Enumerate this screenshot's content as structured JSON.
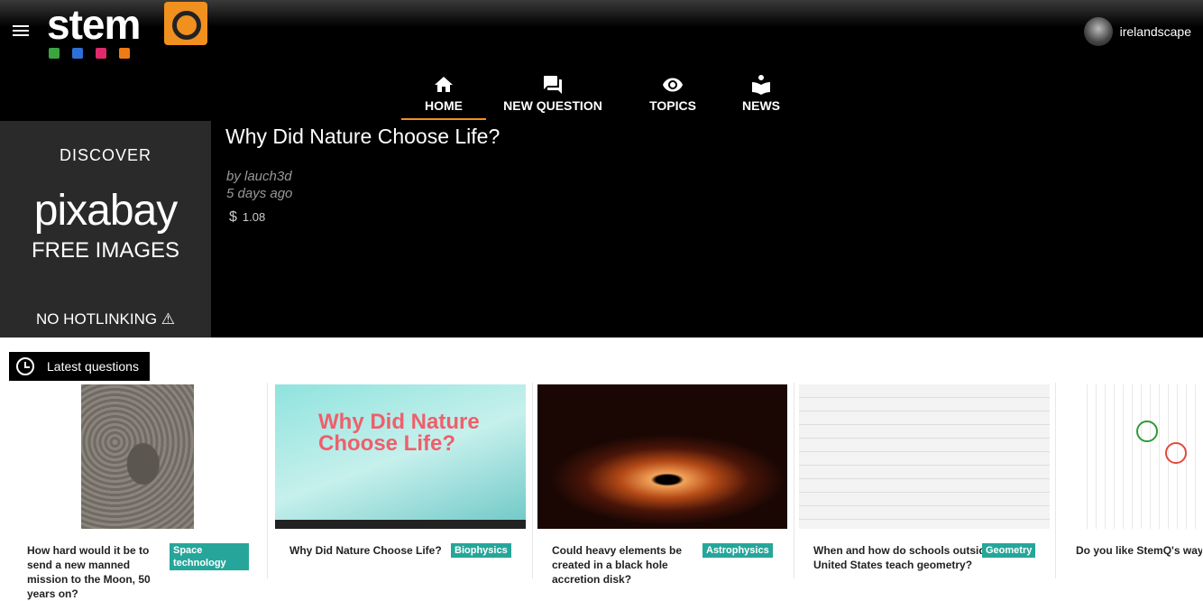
{
  "header": {
    "logo_text": "stem",
    "user": {
      "name": "irelandscape"
    }
  },
  "nav": [
    {
      "label": "HOME",
      "icon": "home-icon",
      "active": true
    },
    {
      "label": "NEW QUESTION",
      "icon": "forum-icon",
      "active": false
    },
    {
      "label": "TOPICS",
      "icon": "eye-icon",
      "active": false
    },
    {
      "label": "NEWS",
      "icon": "book-reader-icon",
      "active": false
    }
  ],
  "ad": {
    "line1": "DISCOVER",
    "line2": "pixabay",
    "line3": "FREE IMAGES",
    "line4": "NO HOTLINKING ⚠"
  },
  "featured": {
    "title": "Why Did Nature Choose Life?",
    "author": "by lauch3d",
    "time": "5 days ago",
    "currency_symbol": "$",
    "amount": "1.08"
  },
  "latest": {
    "label": "Latest questions"
  },
  "cards": [
    {
      "question": "How hard would it be to send a new manned mission to the Moon, 50 years on?",
      "tag": "Space technology"
    },
    {
      "question": "Why Did Nature Choose Life?",
      "tag": "Biophysics",
      "image_text": "Why Did Nature Choose Life?"
    },
    {
      "question": "Could heavy elements be created in a black hole accretion disk?",
      "tag": "Astrophysics"
    },
    {
      "question": "When and how do schools outside the United States teach geometry?",
      "tag": "Geometry"
    },
    {
      "question": "Do you like StemQ's way of contributing questions and answers?",
      "tag": ""
    }
  ],
  "colors": {
    "accent": "#f0901e",
    "tag": "#26a69a"
  }
}
